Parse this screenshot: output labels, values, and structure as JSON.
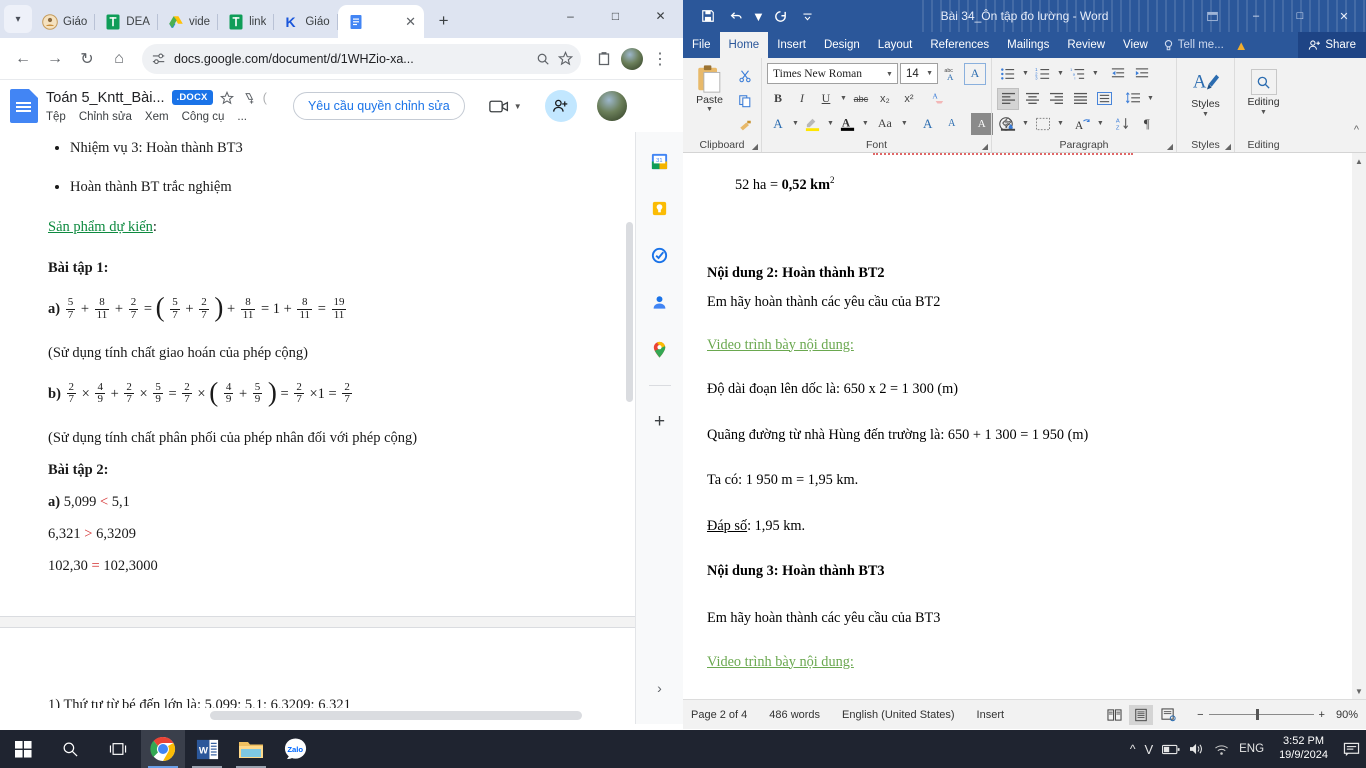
{
  "chrome": {
    "tabs": [
      {
        "title": "Giáo",
        "favicon": "buddhist-icon"
      },
      {
        "title": "DEA",
        "favicon": "forms-icon"
      },
      {
        "title": "vide",
        "favicon": "drive-icon"
      },
      {
        "title": "link",
        "favicon": "forms-icon"
      },
      {
        "title": "Giáo",
        "favicon": "k-icon"
      },
      {
        "title": "",
        "favicon": "docs-icon",
        "active": true
      }
    ],
    "newtab_label": "+",
    "window_controls": {
      "minimize": "–",
      "maximize": "□",
      "close": "✕"
    },
    "toolbar": {
      "back": "←",
      "forward": "→",
      "reload": "↻",
      "home": "⌂",
      "url": "docs.google.com/document/d/1WHZio-xa...",
      "zoom_icon": "search-icon",
      "bookmark_icon": "star-icon",
      "extensions_icon": "extensions-icon",
      "menu_icon": "⋮"
    }
  },
  "gdocs": {
    "title": "Toán 5_Kntt_Bài...",
    "format_badge": ".DOCX",
    "menu": [
      "Tệp",
      "Chỉnh sửa",
      "Xem",
      "Công cụ",
      "..."
    ],
    "request_edit_label": "Yêu cầu quyền chỉnh sửa",
    "star_icon": "star-icon",
    "drive_icon": "drive-add-icon",
    "comment_icon": "comment-icon",
    "meet_icon": "video-camera-icon",
    "share_icon": "add-person-icon",
    "sidebar_icons": [
      "calendar-icon",
      "keep-icon",
      "tasks-icon",
      "contacts-icon",
      "maps-icon"
    ],
    "sidebar_add": "+",
    "sidebar_expand": "›",
    "document": {
      "bullets": [
        "Nhiệm vụ 3: Hoàn thành BT3",
        "Hoàn thành BT trắc nghiệm"
      ],
      "product_heading": "Sản phẩm dự kiến",
      "product_heading_colon": ":",
      "ex1_heading": "Bài tập 1:",
      "ex1a_label": "a)",
      "ex1a": {
        "f1": [
          "5",
          "7"
        ],
        "op1": "+",
        "f2": [
          "8",
          "11"
        ],
        "op2": "+",
        "f3": [
          "2",
          "7"
        ],
        "eq1": "=",
        "open": "(",
        "f4": [
          "5",
          "7"
        ],
        "op3": "+",
        "f5": [
          "2",
          "7"
        ],
        "close": ")",
        "op4": "+",
        "f6": [
          "8",
          "11"
        ],
        "eq2": "=",
        "one": "1",
        "op5": "+",
        "f7": [
          "8",
          "11"
        ],
        "eq3": "=",
        "f8": [
          "19",
          "11"
        ]
      },
      "ex1a_note": "(Sử dụng tính chất giao hoán của phép cộng)",
      "ex1b_label": "b)",
      "ex1b": {
        "f1": [
          "2",
          "7"
        ],
        "op1": "×",
        "f2": [
          "4",
          "9"
        ],
        "op2": "+",
        "f3": [
          "2",
          "7"
        ],
        "op3": "×",
        "f4": [
          "5",
          "9"
        ],
        "eq1": "=",
        "f5": [
          "2",
          "7"
        ],
        "op4": "×",
        "open": "(",
        "f6": [
          "4",
          "9"
        ],
        "op5": "+",
        "f7": [
          "5",
          "9"
        ],
        "close": ")",
        "eq2": "=",
        "f8": [
          "2",
          "7"
        ],
        "op6": "×1",
        "eq3": "=",
        "f9": [
          "2",
          "7"
        ]
      },
      "ex1b_note": "(Sử dụng tính chất phân phối của phép nhân đối với phép cộng)",
      "ex2_heading": "Bài tập 2:",
      "ex2a_label": "a)",
      "ex2_lines": [
        {
          "left": "5,099",
          "sign": "<",
          "right": "5,1"
        },
        {
          "left": "6,321",
          "sign": ">",
          "right": "6,3209"
        },
        {
          "left": "102,30",
          "sign": "=",
          "right": "102,3000"
        }
      ],
      "cut_line": "1) Thứ tự từ bé đến lớn là:  5,099; 5,1; 6,3209; 6,321"
    }
  },
  "word": {
    "title": "Bài 34_Ôn tập đo lường - Word",
    "quick_access": [
      "save-icon",
      "undo-icon",
      "redo-icon",
      "customize-icon"
    ],
    "window_controls": {
      "ribbon": "ribbon-display-icon",
      "minimize": "–",
      "maximize": "□",
      "close": "✕"
    },
    "tabs": [
      "File",
      "Home",
      "Insert",
      "Design",
      "Layout",
      "References",
      "Mailings",
      "Review",
      "View"
    ],
    "active_tab": "Home",
    "tell_me": "Tell me...",
    "share_label": "Share",
    "ribbon": {
      "clipboard": {
        "label": "Clipboard",
        "paste": "Paste",
        "cut": "scissors-icon",
        "copy": "copy-icon",
        "format_painter": "format-painter-icon"
      },
      "font": {
        "label": "Font",
        "font_name": "Times New Roman",
        "font_size": "14",
        "bold": "B",
        "italic": "I",
        "underline": "U",
        "strikethrough": "abc",
        "subscript": "x₂",
        "superscript": "x²",
        "clear_format": "clear-formatting-icon",
        "text_effects": "A",
        "highlight": "highlight-icon",
        "font_color": "A",
        "change_case": "Aa",
        "grow_font": "A",
        "shrink_font": "A",
        "phonetic": "A",
        "enclose": "enclose-char-icon"
      },
      "paragraph": {
        "label": "Paragraph",
        "bullets": "bullet-list-icon",
        "numbering": "numbered-list-icon",
        "multilevel": "multilevel-list-icon",
        "decrease_indent": "decrease-indent-icon",
        "increase_indent": "increase-indent-icon",
        "align_left": "align-left-icon",
        "align_center": "align-center-icon",
        "align_right": "align-right-icon",
        "justify": "justify-icon",
        "line_spacing": "line-spacing-icon",
        "shading": "shading-icon",
        "borders": "borders-icon",
        "sort": "sort-icon",
        "show_marks": "¶"
      },
      "styles": {
        "label": "Styles",
        "button": "Styles"
      },
      "editing": {
        "label": "Editing",
        "button": "Editing",
        "icon": "search-icon"
      },
      "collapse": "^"
    },
    "document": [
      {
        "type": "mixed",
        "indent": true,
        "parts": [
          {
            "t": "52 ha = ",
            "b": false
          },
          {
            "t": "0,52",
            "b": true
          },
          {
            "t": " km",
            "b": false
          },
          {
            "t": "2",
            "b": false,
            "sup": true
          }
        ]
      },
      {
        "type": "gap"
      },
      {
        "type": "gap"
      },
      {
        "type": "bold",
        "text": "Nội dung 2: Hoàn thành BT2"
      },
      {
        "type": "plain",
        "text": "Em hãy hoàn thành các yêu cầu của BT2"
      },
      {
        "type": "link",
        "text": "Video trình bày nội dung:"
      },
      {
        "type": "plain",
        "text": "Độ dài đoạn lên dốc là:  650 x 2 = 1 300 (m)"
      },
      {
        "type": "plain",
        "text": "Quãng đường từ nhà Hùng đến trường là:  650 + 1 300 = 1 950 (m)"
      },
      {
        "type": "plain",
        "text": "Ta có: 1 950 m = 1,95 km."
      },
      {
        "type": "underline-prefix",
        "prefix": "Đáp số",
        "text": ": 1,95 km."
      },
      {
        "type": "bold",
        "text": "Nội dung 3: Hoàn thành BT3"
      },
      {
        "type": "plain",
        "text": "Em hãy hoàn thành các yêu cầu của BT3"
      },
      {
        "type": "link",
        "text": "Video trình bày nội dung:"
      }
    ],
    "status": {
      "page": "Page 2 of 4",
      "words": "486 words",
      "language": "English (United States)",
      "mode": "Insert",
      "view_read": "read-mode-icon",
      "view_print": "print-layout-icon",
      "view_web": "web-layout-icon",
      "zoom_out": "−",
      "zoom_in": "+",
      "zoom_level": "90%"
    }
  },
  "taskbar": {
    "start": "windows-logo-icon",
    "search": "search-icon",
    "taskview": "task-view-icon",
    "apps": [
      {
        "name": "chrome-icon",
        "active": true
      },
      {
        "name": "word-icon",
        "active": false
      },
      {
        "name": "file-explorer-icon",
        "active": false
      },
      {
        "name": "zalo-icon",
        "active": false
      }
    ],
    "tray": {
      "show_hidden": "^",
      "vpn": "V",
      "battery": "battery-icon",
      "volume": "volume-icon",
      "wifi": "wifi-icon",
      "language": "ENG",
      "time": "3:52 PM",
      "date": "19/9/2024",
      "notifications": "notification-icon"
    }
  },
  "colors": {
    "chrome_tabstrip": "#dee4f1",
    "word_blue": "#2b579a",
    "google_blue": "#1a73e8",
    "link_green": "#0d8a3f",
    "red": "#d32f2f",
    "taskbar": "#1f2430"
  }
}
